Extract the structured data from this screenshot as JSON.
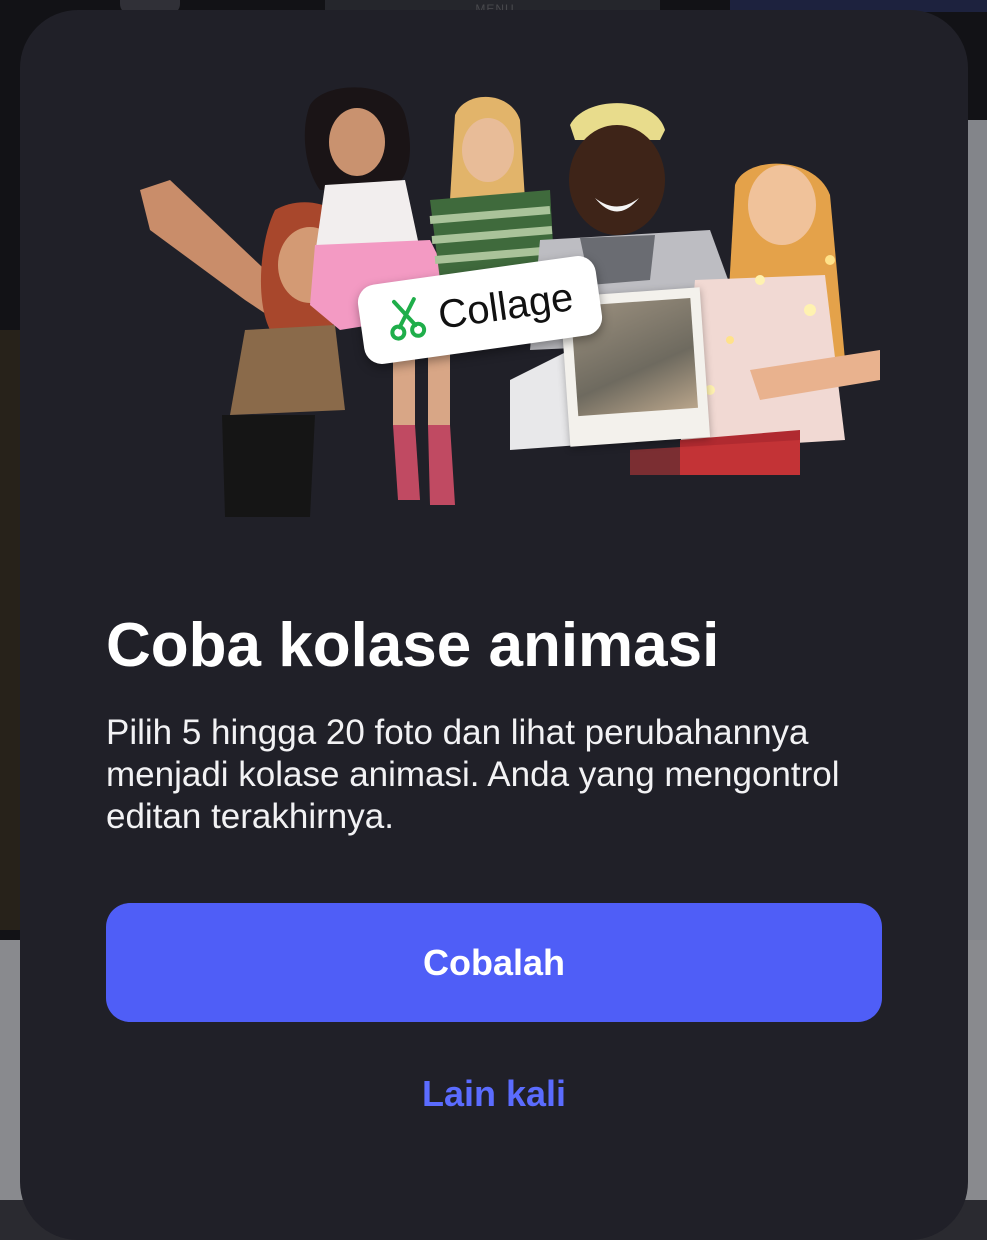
{
  "background": {
    "menu_label": "MENU"
  },
  "modal": {
    "sticker_label": "Collage",
    "title": "Coba kolase animasi",
    "description": "Pilih 5 hingga 20 foto dan lihat perubahannya menjadi kolase animasi. Anda yang mengontrol editan terakhirnya.",
    "primary_button": "Cobalah",
    "secondary_button": "Lain kali"
  },
  "colors": {
    "sheet": "#202028",
    "accent": "#4f5ef7",
    "link": "#5b6cff",
    "scissors_icon": "#1fae4a"
  }
}
